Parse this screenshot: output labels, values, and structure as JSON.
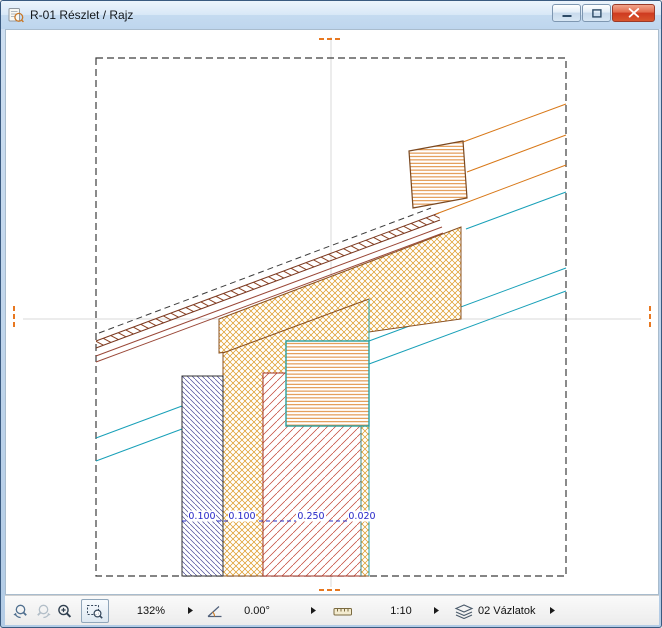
{
  "window": {
    "title": "R-01 Részlet / Rajz"
  },
  "canvas": {
    "dimension_labels": [
      "0.100",
      "0.100",
      "0.250",
      "0.020"
    ]
  },
  "statusbar": {
    "zoom": {
      "value": "132%"
    },
    "rotation": {
      "value": "0.00°"
    },
    "scale": {
      "value": "1:10"
    },
    "layer": {
      "value": "02 Vázlatok"
    }
  },
  "icons": {
    "titlebar": "detail-drawing-icon",
    "window_controls": [
      "minimize-icon",
      "maximize-icon",
      "close-icon"
    ],
    "statusbar": [
      "zoom-previous-icon",
      "zoom-next-icon",
      "zoom-in-icon",
      "fit-view-icon",
      "angle-icon",
      "scale-icon",
      "layers-icon",
      "flyout-arrow-icon"
    ]
  },
  "colors": {
    "hatch_orange": "#dc9820",
    "hatch_red": "#c04030",
    "hatch_blue": "#4a4a9a",
    "teal_line": "#18a0b8",
    "marker_orange": "#e87820",
    "dimension_blue": "#2828c8",
    "close_button_red": "#ce3a20"
  }
}
